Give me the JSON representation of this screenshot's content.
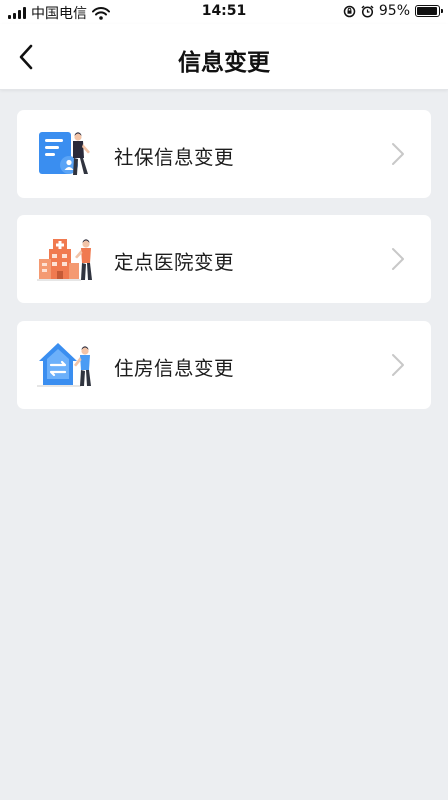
{
  "status": {
    "carrier": "中国电信",
    "time": "14:51",
    "battery": "95%",
    "battery_level": 0.95
  },
  "nav": {
    "title": "信息变更",
    "back_icon": "chevron-left-icon"
  },
  "menu": {
    "items": [
      {
        "label": "社保信息变更",
        "icon": "social-security-document-icon"
      },
      {
        "label": "定点医院变更",
        "icon": "hospital-icon"
      },
      {
        "label": "住房信息变更",
        "icon": "house-exchange-icon"
      }
    ],
    "chevron_icon": "chevron-right-icon"
  },
  "colors": {
    "page_bg": "#eceef1",
    "card_bg": "#ffffff",
    "icon_blue": "#3a8ef0",
    "icon_orange": "#f07a50",
    "chevron": "#c8c8c8"
  }
}
